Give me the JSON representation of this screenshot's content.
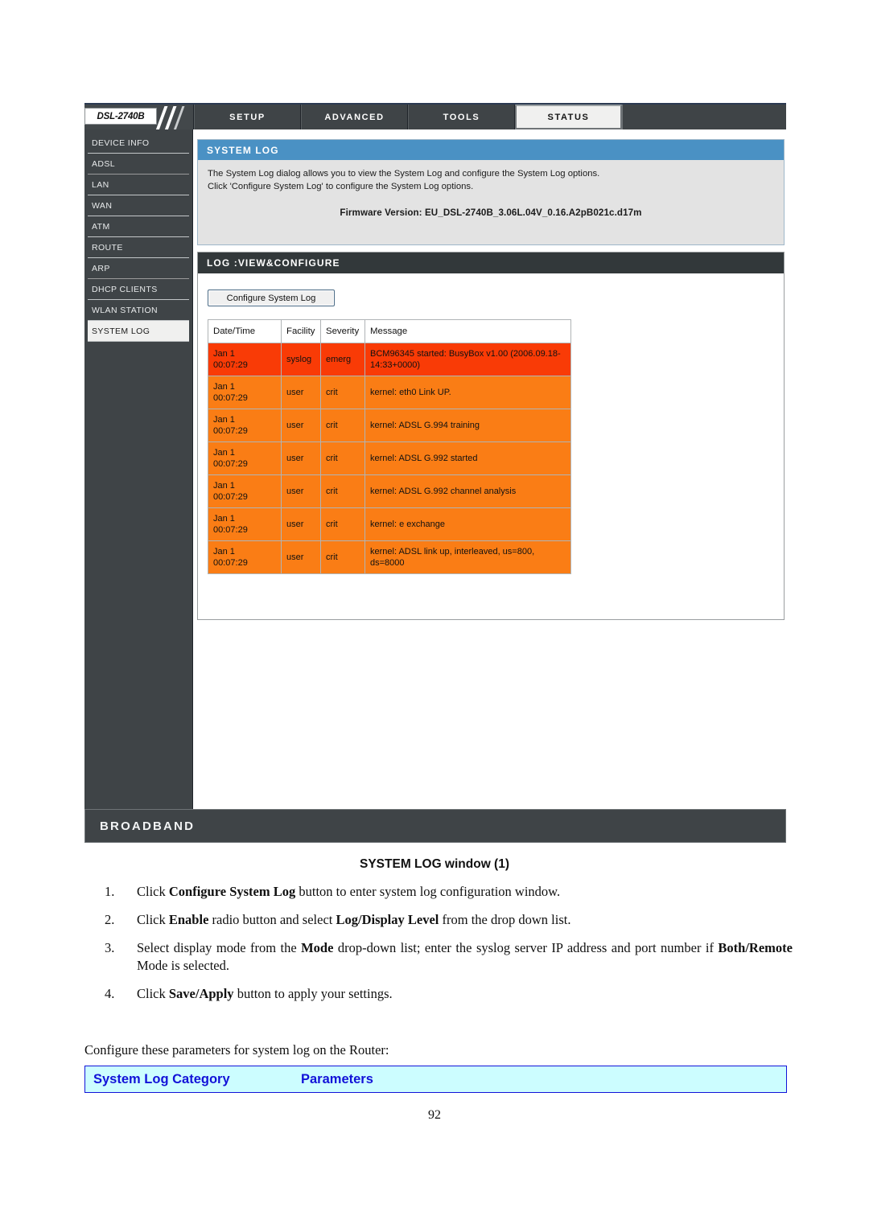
{
  "router_ui": {
    "brand": "DSL-2740B",
    "nav_tabs": [
      {
        "label": "SETUP",
        "active": false
      },
      {
        "label": "ADVANCED",
        "active": false
      },
      {
        "label": "TOOLS",
        "active": false
      },
      {
        "label": "STATUS",
        "active": true
      }
    ],
    "sidebar": {
      "items": [
        {
          "label": "DEVICE INFO",
          "active": false
        },
        {
          "label": "ADSL",
          "active": false
        },
        {
          "label": "LAN",
          "active": false
        },
        {
          "label": "WAN",
          "active": false
        },
        {
          "label": "ATM",
          "active": false
        },
        {
          "label": "ROUTE",
          "active": false
        },
        {
          "label": "ARP",
          "active": false
        },
        {
          "label": "DHCP CLIENTS",
          "active": false
        },
        {
          "label": "WLAN STATION",
          "active": false
        },
        {
          "label": "SYSTEM LOG",
          "active": true
        }
      ]
    },
    "info_panel": {
      "title": "SYSTEM LOG",
      "line1": "The System Log dialog allows you to view the System Log and configure the System Log options.",
      "line2": "Click 'Configure System Log' to configure the System Log options.",
      "firmware": "Firmware Version: EU_DSL-2740B_3.06L.04V_0.16.A2pB021c.d17m"
    },
    "log_panel": {
      "title": "LOG :VIEW&CONFIGURE",
      "configure_button": "Configure System Log",
      "table": {
        "headers": [
          "Date/Time",
          "Facility",
          "Severity",
          "Message"
        ],
        "rows": [
          {
            "datetime": "Jan 1\n00:07:29",
            "facility": "syslog",
            "severity": "emerg",
            "message": "BCM96345 started: BusyBox v1.00 (2006.09.18-14:33+0000)"
          },
          {
            "datetime": "Jan 1\n00:07:29",
            "facility": "user",
            "severity": "crit",
            "message": "kernel: eth0 Link UP."
          },
          {
            "datetime": "Jan 1\n00:07:29",
            "facility": "user",
            "severity": "crit",
            "message": "kernel: ADSL G.994 training"
          },
          {
            "datetime": "Jan 1\n00:07:29",
            "facility": "user",
            "severity": "crit",
            "message": "kernel: ADSL G.992 started"
          },
          {
            "datetime": "Jan 1\n00:07:29",
            "facility": "user",
            "severity": "crit",
            "message": "kernel: ADSL G.992 channel analysis"
          },
          {
            "datetime": "Jan 1\n00:07:29",
            "facility": "user",
            "severity": "crit",
            "message": "kernel: e exchange"
          },
          {
            "datetime": "Jan 1\n00:07:29",
            "facility": "user",
            "severity": "crit",
            "message": "kernel: ADSL link up, interleaved, us=800, ds=8000"
          }
        ]
      }
    },
    "footer": {
      "label": "BROADBAND"
    },
    "colors": {
      "nav_dark": "#3f4447",
      "panel_blue": "#4a91c4",
      "panel_dark": "#32383a",
      "row_emerg": "#f93b06",
      "row_crit": "#fa7d15"
    }
  },
  "document": {
    "figure_caption": "SYSTEM LOG window (1)",
    "steps": [
      {
        "num": "1.",
        "parts": [
          {
            "t": "Click ",
            "b": false
          },
          {
            "t": "Configure System Log",
            "b": true
          },
          {
            "t": " button to enter system log configuration window.",
            "b": false
          }
        ]
      },
      {
        "num": "2.",
        "parts": [
          {
            "t": "Click ",
            "b": false
          },
          {
            "t": "Enable",
            "b": true
          },
          {
            "t": " radio button and select ",
            "b": false
          },
          {
            "t": "Log/Display Level",
            "b": true
          },
          {
            "t": " from the drop down list.",
            "b": false
          }
        ]
      },
      {
        "num": "3.",
        "parts": [
          {
            "t": "Select display mode from the ",
            "b": false
          },
          {
            "t": "Mode",
            "b": true
          },
          {
            "t": " drop-down list; enter the syslog server IP address and port number if ",
            "b": false
          },
          {
            "t": "Both/Remote",
            "b": true
          },
          {
            "t": " Mode is selected.",
            "b": false
          }
        ]
      },
      {
        "num": "4.",
        "parts": [
          {
            "t": "Click ",
            "b": false
          },
          {
            "t": "Save/Apply",
            "b": true
          },
          {
            "t": " button to apply your settings.",
            "b": false
          }
        ]
      }
    ],
    "intro_paragraph": "Configure these parameters for system log on the Router:",
    "param_table": {
      "col1": "System Log Category",
      "col2": "Parameters"
    },
    "page_number": "92"
  }
}
